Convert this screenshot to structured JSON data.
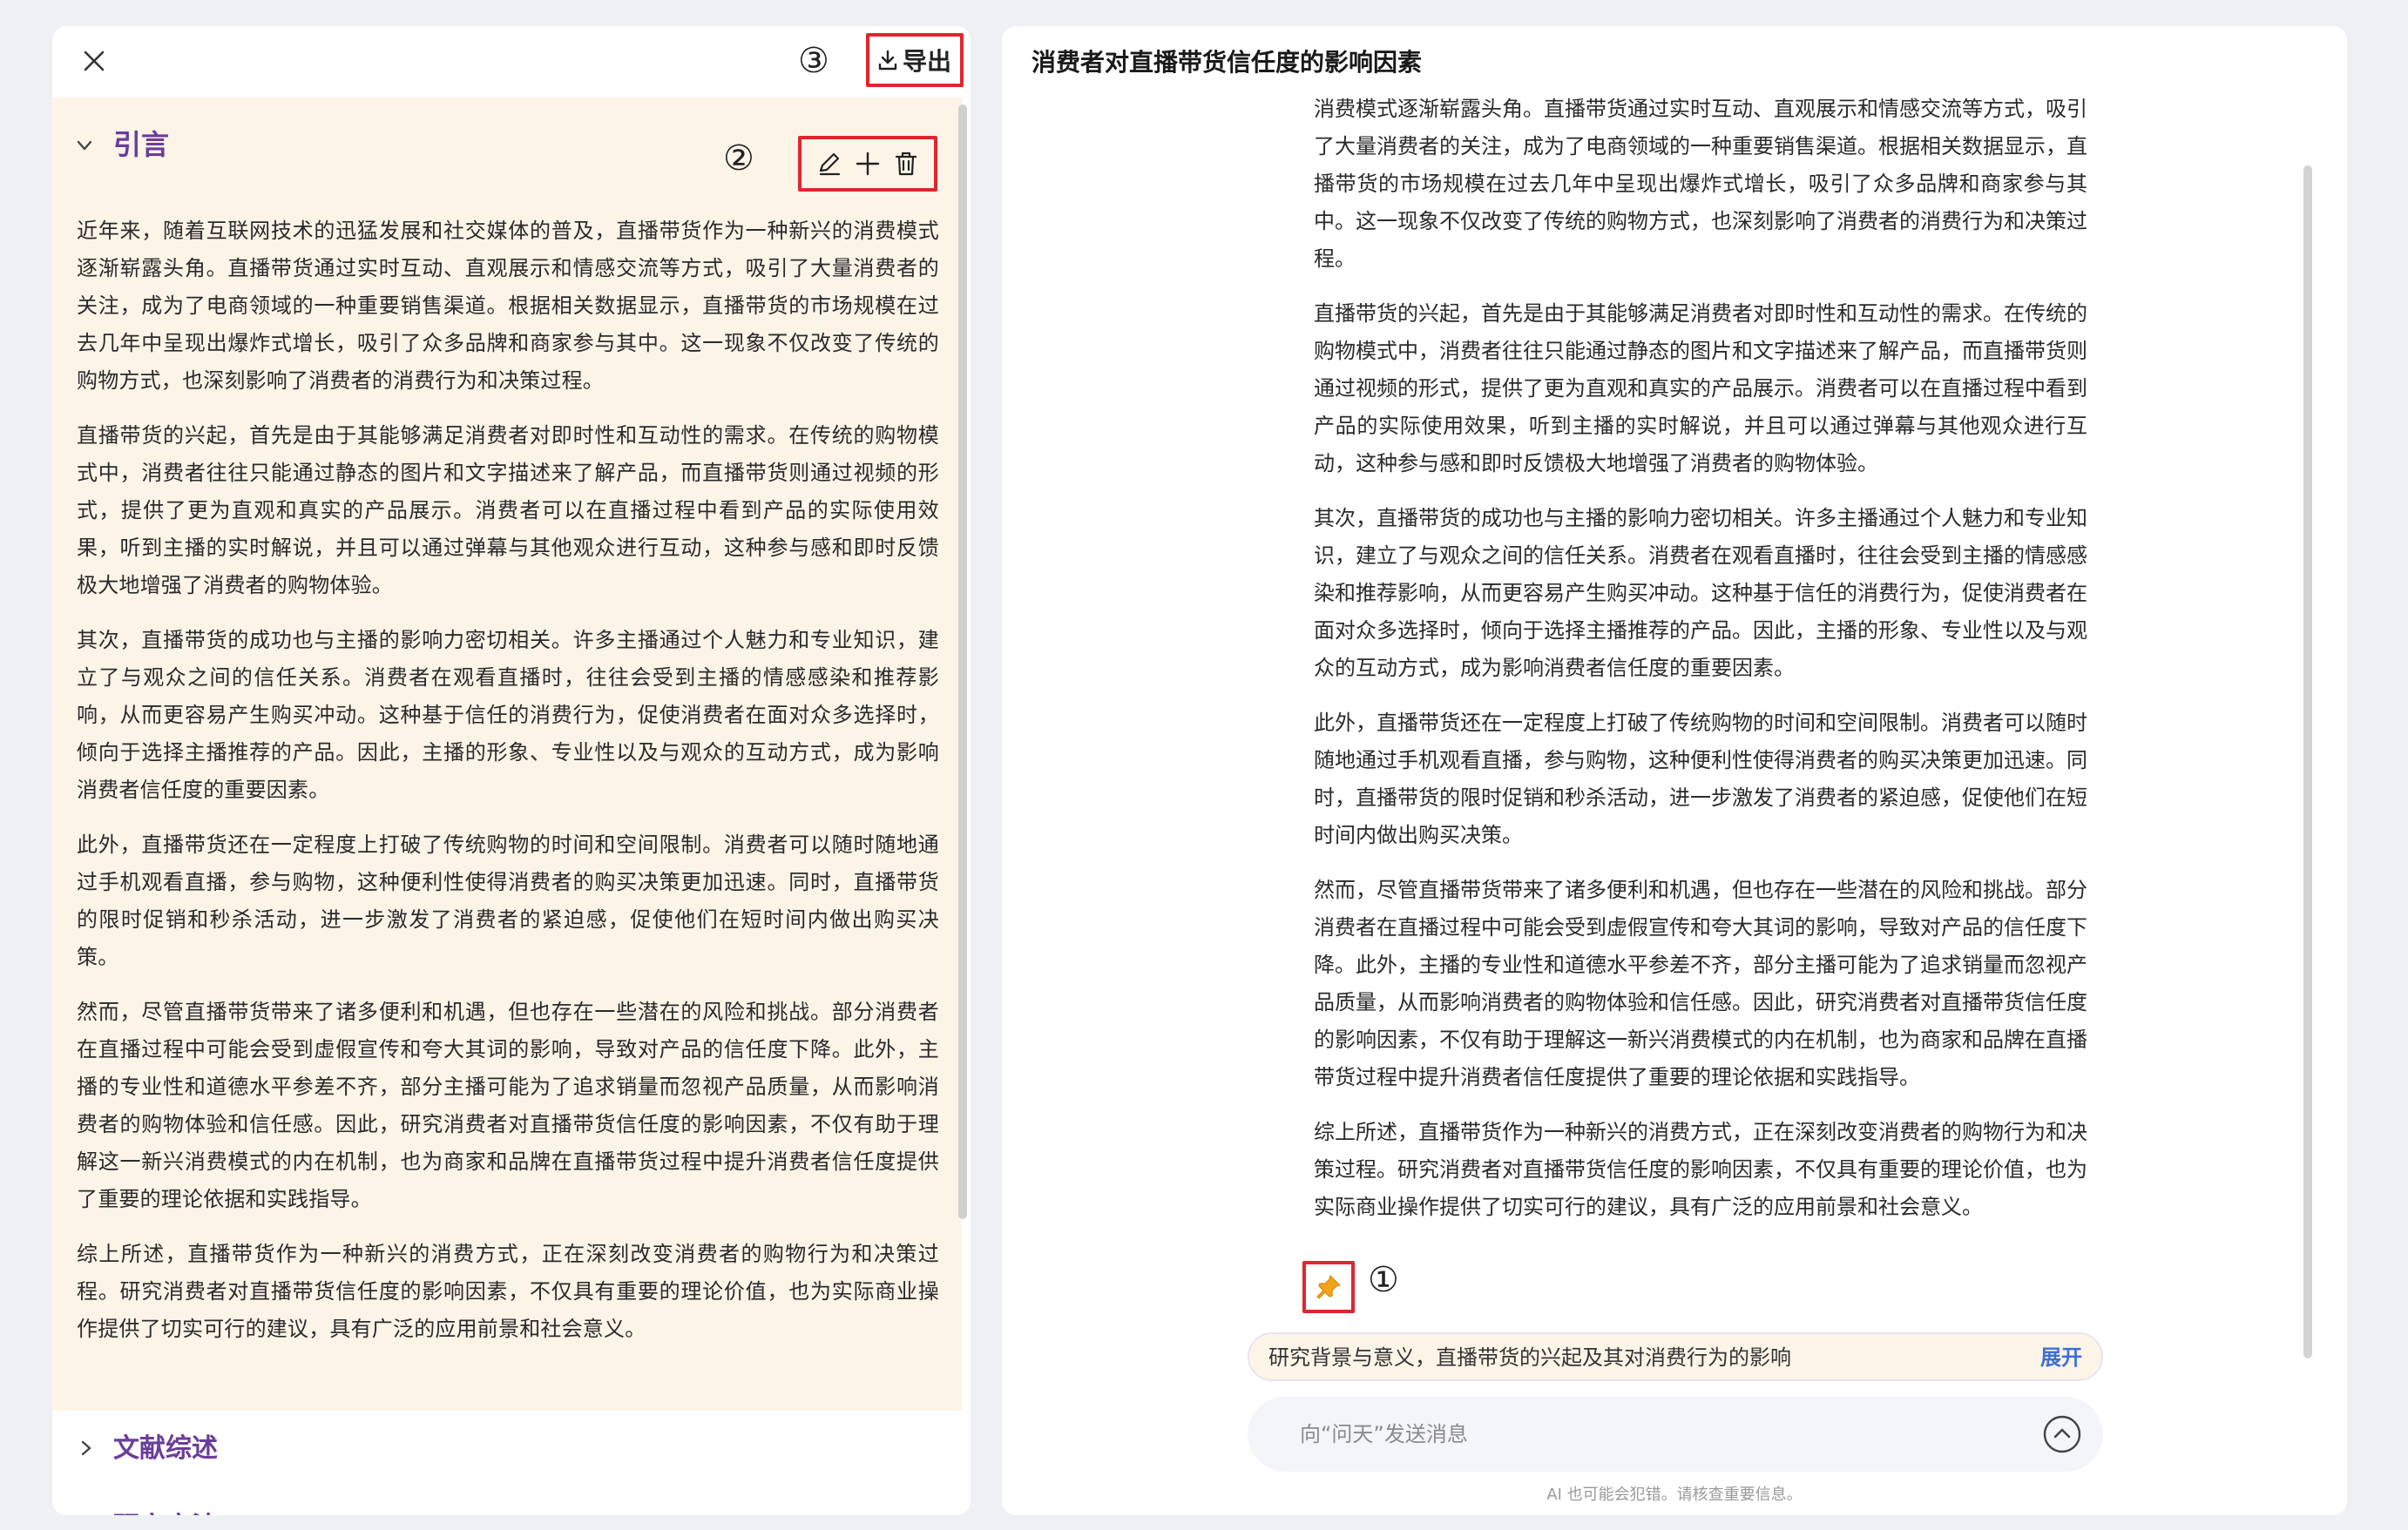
{
  "left_panel": {
    "markers": {
      "export": "③",
      "actions": "②"
    },
    "export_label": "导出",
    "active_section": {
      "title": "引言",
      "paragraphs": [
        "近年来，随着互联网技术的迅猛发展和社交媒体的普及，直播带货作为一种新兴的消费模式逐渐崭露头角。直播带货通过实时互动、直观展示和情感交流等方式，吸引了大量消费者的关注，成为了电商领域的一种重要销售渠道。根据相关数据显示，直播带货的市场规模在过去几年中呈现出爆炸式增长，吸引了众多品牌和商家参与其中。这一现象不仅改变了传统的购物方式，也深刻影响了消费者的消费行为和决策过程。",
        "直播带货的兴起，首先是由于其能够满足消费者对即时性和互动性的需求。在传统的购物模式中，消费者往往只能通过静态的图片和文字描述来了解产品，而直播带货则通过视频的形式，提供了更为直观和真实的产品展示。消费者可以在直播过程中看到产品的实际使用效果，听到主播的实时解说，并且可以通过弹幕与其他观众进行互动，这种参与感和即时反馈极大地增强了消费者的购物体验。",
        "其次，直播带货的成功也与主播的影响力密切相关。许多主播通过个人魅力和专业知识，建立了与观众之间的信任关系。消费者在观看直播时，往往会受到主播的情感感染和推荐影响，从而更容易产生购买冲动。这种基于信任的消费行为，促使消费者在面对众多选择时，倾向于选择主播推荐的产品。因此，主播的形象、专业性以及与观众的互动方式，成为影响消费者信任度的重要因素。",
        "此外，直播带货还在一定程度上打破了传统购物的时间和空间限制。消费者可以随时随地通过手机观看直播，参与购物，这种便利性使得消费者的购买决策更加迅速。同时，直播带货的限时促销和秒杀活动，进一步激发了消费者的紧迫感，促使他们在短时间内做出购买决策。",
        "然而，尽管直播带货带来了诸多便利和机遇，但也存在一些潜在的风险和挑战。部分消费者在直播过程中可能会受到虚假宣传和夸大其词的影响，导致对产品的信任度下降。此外，主播的专业性和道德水平参差不齐，部分主播可能为了追求销量而忽视产品质量，从而影响消费者的购物体验和信任感。因此，研究消费者对直播带货信任度的影响因素，不仅有助于理解这一新兴消费模式的内在机制，也为商家和品牌在直播带货过程中提升消费者信任度提供了重要的理论依据和实践指导。",
        "综上所述，直播带货作为一种新兴的消费方式，正在深刻改变消费者的购物行为和决策过程。研究消费者对直播带货信任度的影响因素，不仅具有重要的理论价值，也为实际商业操作提供了切实可行的建议，具有广泛的应用前景和社会意义。"
      ]
    },
    "collapsed_sections": [
      "文献综述",
      "研究方法"
    ]
  },
  "right_panel": {
    "title": "消费者对直播带货信任度的影响因素",
    "paragraphs": [
      "消费模式逐渐崭露头角。直播带货通过实时互动、直观展示和情感交流等方式，吸引了大量消费者的关注，成为了电商领域的一种重要销售渠道。根据相关数据显示，直播带货的市场规模在过去几年中呈现出爆炸式增长，吸引了众多品牌和商家参与其中。这一现象不仅改变了传统的购物方式，也深刻影响了消费者的消费行为和决策过程。",
      "直播带货的兴起，首先是由于其能够满足消费者对即时性和互动性的需求。在传统的购物模式中，消费者往往只能通过静态的图片和文字描述来了解产品，而直播带货则通过视频的形式，提供了更为直观和真实的产品展示。消费者可以在直播过程中看到产品的实际使用效果，听到主播的实时解说，并且可以通过弹幕与其他观众进行互动，这种参与感和即时反馈极大地增强了消费者的购物体验。",
      "其次，直播带货的成功也与主播的影响力密切相关。许多主播通过个人魅力和专业知识，建立了与观众之间的信任关系。消费者在观看直播时，往往会受到主播的情感感染和推荐影响，从而更容易产生购买冲动。这种基于信任的消费行为，促使消费者在面对众多选择时，倾向于选择主播推荐的产品。因此，主播的形象、专业性以及与观众的互动方式，成为影响消费者信任度的重要因素。",
      "此外，直播带货还在一定程度上打破了传统购物的时间和空间限制。消费者可以随时随地通过手机观看直播，参与购物，这种便利性使得消费者的购买决策更加迅速。同时，直播带货的限时促销和秒杀活动，进一步激发了消费者的紧迫感，促使他们在短时间内做出购买决策。",
      "然而，尽管直播带货带来了诸多便利和机遇，但也存在一些潜在的风险和挑战。部分消费者在直播过程中可能会受到虚假宣传和夸大其词的影响，导致对产品的信任度下降。此外，主播的专业性和道德水平参差不齐，部分主播可能为了追求销量而忽视产品质量，从而影响消费者的购物体验和信任感。因此，研究消费者对直播带货信任度的影响因素，不仅有助于理解这一新兴消费模式的内在机制，也为商家和品牌在直播带货过程中提升消费者信任度提供了重要的理论依据和实践指导。",
      "综上所述，直播带货作为一种新兴的消费方式，正在深刻改变消费者的购物行为和决策过程。研究消费者对直播带货信任度的影响因素，不仅具有重要的理论价值，也为实际商业操作提供了切实可行的建议，具有广泛的应用前景和社会意义。"
    ],
    "pin_marker": "①",
    "context_text": "研究背景与意义，直播带货的兴起及其对消费行为的影响",
    "context_expand": "展开",
    "input_placeholder": "向“问天”发送消息",
    "disclaimer": "AI 也可能会犯错。请核查重要信息。"
  },
  "colors": {
    "accent_purple": "#6a3d9a",
    "highlight_bg": "#fdf4e8",
    "annotation_red": "#e0262f",
    "link_blue": "#3b6fd6",
    "pin_orange": "#f2a31b"
  },
  "icons": [
    "close-icon",
    "download-icon",
    "chevron-down-icon",
    "edit-icon",
    "plus-icon",
    "trash-icon",
    "chevron-right-icon",
    "pin-icon",
    "send-up-icon"
  ]
}
